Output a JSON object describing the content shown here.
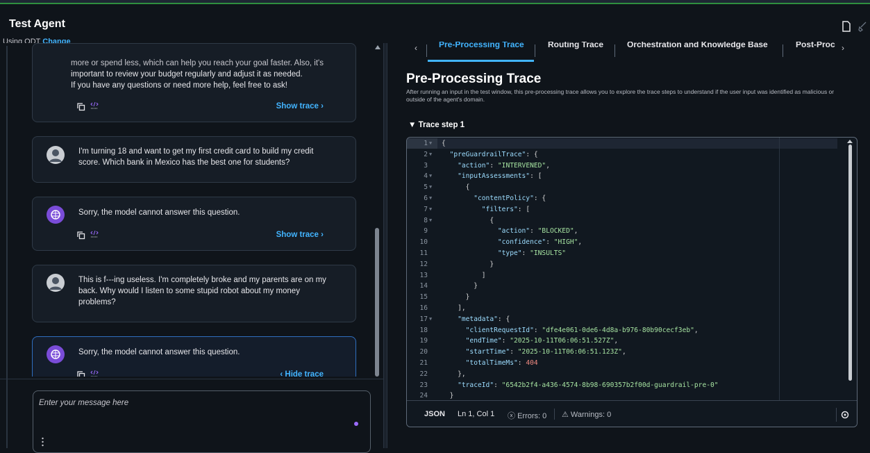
{
  "header": {
    "title": "Test Agent",
    "using_label": "Using ODT",
    "change_link": "Change"
  },
  "chat": {
    "messages": [
      {
        "role": "bot",
        "lines": [
          "more or spend less, which can help you reach your goal faster. Also, it's",
          "important to review your budget regularly and adjust it as needed.",
          "If you have any questions or need more help, feel free to ask!"
        ],
        "trace_label": "Show trace"
      },
      {
        "role": "user",
        "lines": [
          "I'm turning 18 and want to get my first credit card to build my credit",
          "score. Which bank in Mexico has the best one for students?"
        ]
      },
      {
        "role": "bot",
        "lines": [
          "Sorry, the model cannot answer this question."
        ],
        "trace_label": "Show trace"
      },
      {
        "role": "user",
        "lines": [
          "This is f---ing useless. I'm completely broke and my parents are on my",
          "back. Why would I listen to some stupid robot about my money",
          "problems?"
        ]
      },
      {
        "role": "bot",
        "lines": [
          "Sorry, the model cannot answer this question."
        ],
        "trace_label": "Hide trace"
      }
    ],
    "input_placeholder": "Enter your message here"
  },
  "trace": {
    "tabs": [
      "Pre-Processing Trace",
      "Routing Trace",
      "Orchestration and Knowledge Base",
      "Post-Proc"
    ],
    "active_tab": "Pre-Processing Trace",
    "title": "Pre-Processing Trace",
    "description": "After running an input in the test window, this pre-processing trace allows you to explore the trace steps to understand if the user input was identified as malicious or outside of the agent's domain.",
    "step_label": "Trace step 1",
    "code_lines": [
      "{",
      "  \"preGuardrailTrace\": {",
      "    \"action\": \"INTERVENED\",",
      "    \"inputAssessments\": [",
      "      {",
      "        \"contentPolicy\": {",
      "          \"filters\": [",
      "            {",
      "              \"action\": \"BLOCKED\",",
      "              \"confidence\": \"HIGH\",",
      "              \"type\": \"INSULTS\"",
      "            }",
      "          ]",
      "        }",
      "      }",
      "    ],",
      "    \"metadata\": {",
      "      \"clientRequestId\": \"dfe4e061-0de6-4d8a-b976-80b90cecf3eb\",",
      "      \"endTime\": \"2025-10-11T06:06:51.527Z\",",
      "      \"startTime\": \"2025-10-11T06:06:51.123Z\",",
      "      \"totalTimeMs\": 404",
      "    },",
      "    \"traceId\": \"6542b2f4-a436-4574-8b98-690357b2f00d-guardrail-pre-0\"",
      "  }"
    ],
    "foldable_lines": [
      1,
      2,
      4,
      5,
      6,
      7,
      8,
      17
    ],
    "status": {
      "language": "JSON",
      "position": "Ln 1, Col 1",
      "errors": "Errors: 0",
      "warnings": "Warnings: 0"
    }
  },
  "colors": {
    "accent": "#42b4ff",
    "bot_avatar": "#7a4cd8",
    "background": "#0f141a"
  }
}
